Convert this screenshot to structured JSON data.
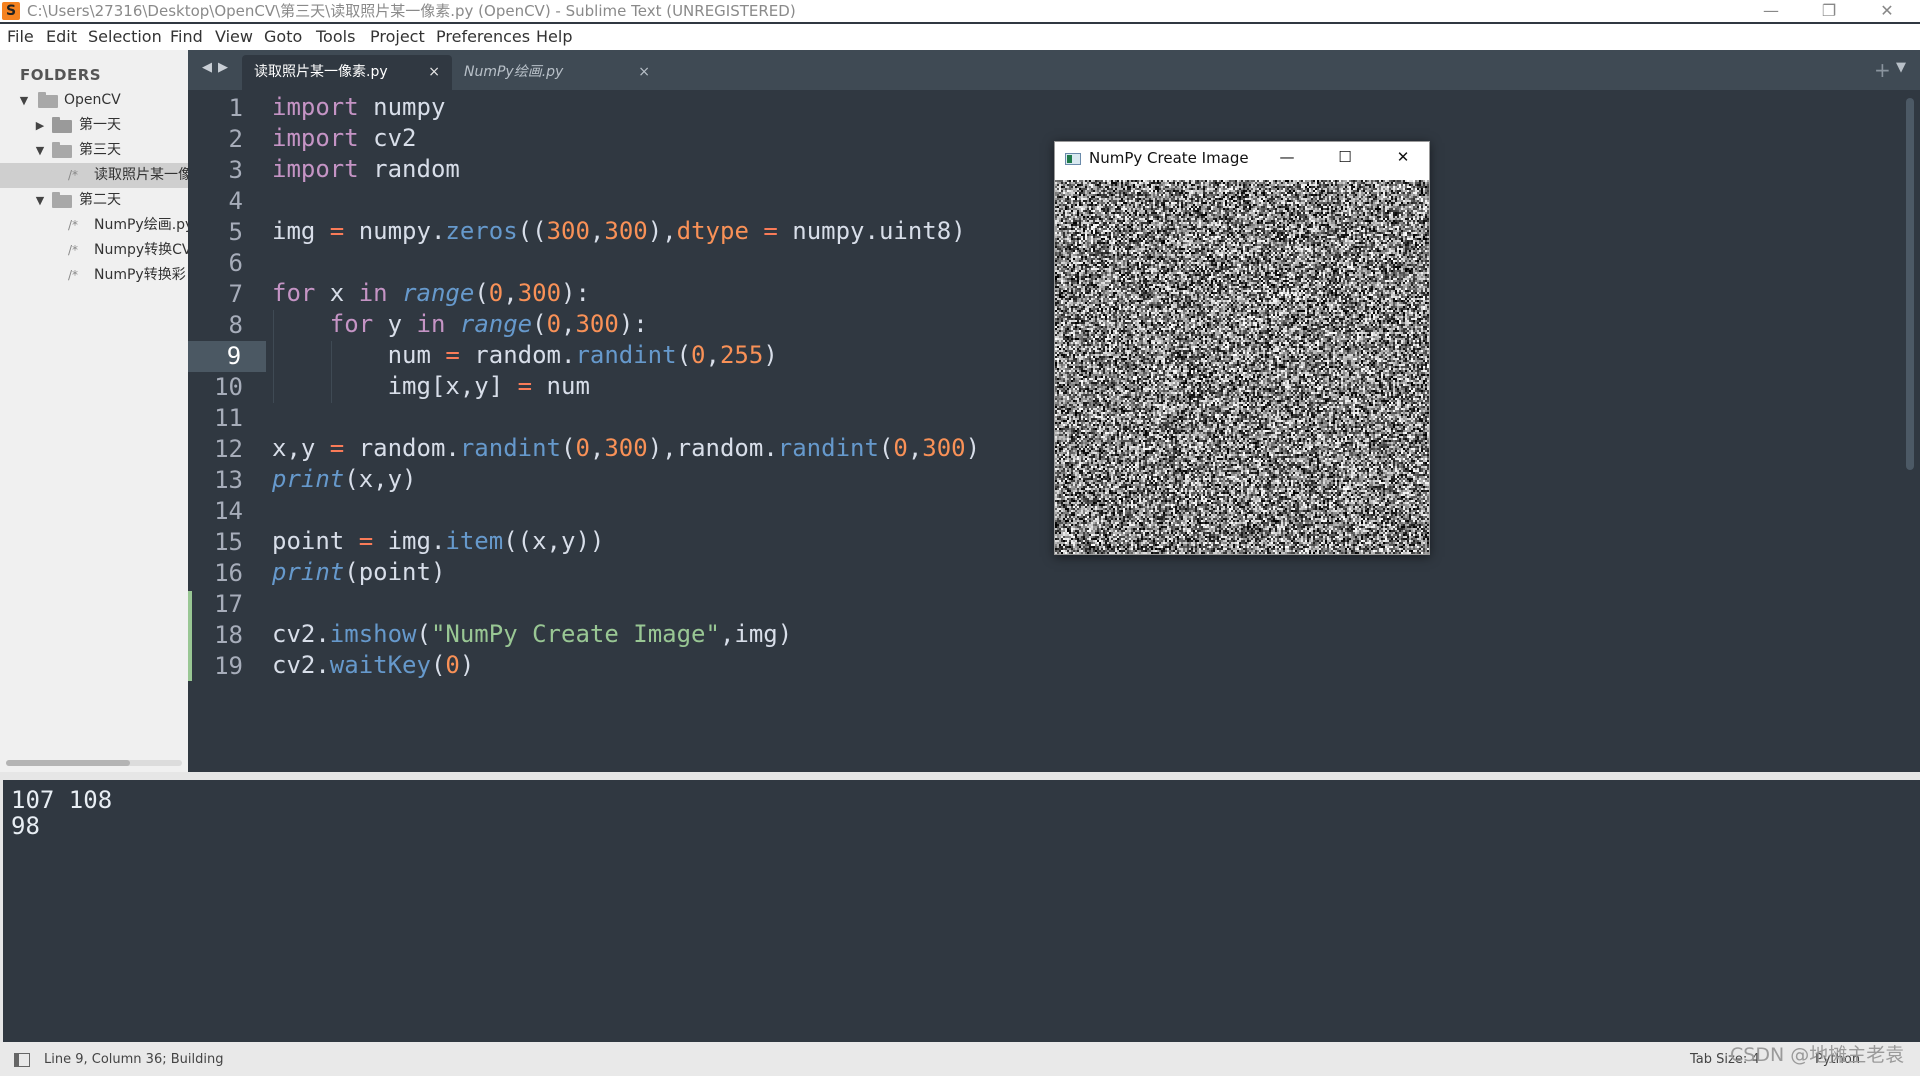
{
  "window": {
    "title": "C:\\Users\\27316\\Desktop\\OpenCV\\第三天\\读取照片某一像素.py (OpenCV) - Sublime Text (UNREGISTERED)",
    "minimize": "—",
    "maximize": "❐",
    "close": "✕",
    "app_icon": "S"
  },
  "menu": [
    "File",
    "Edit",
    "Selection",
    "Find",
    "View",
    "Goto",
    "Tools",
    "Project",
    "Preferences",
    "Help"
  ],
  "sidebar": {
    "header": "FOLDERS",
    "items": [
      {
        "type": "folder",
        "label": "OpenCV",
        "expanded": true
      },
      {
        "type": "folder",
        "label": "第一天",
        "expanded": false
      },
      {
        "type": "folder",
        "label": "第三天",
        "expanded": true
      },
      {
        "type": "file",
        "label": "读取照片某一像素.py",
        "display": "读取照片某一像",
        "selected": true
      },
      {
        "type": "folder",
        "label": "第二天",
        "expanded": true
      },
      {
        "type": "file",
        "label": "NumPy绘画.py",
        "display": "NumPy绘画.py"
      },
      {
        "type": "file",
        "label": "Numpy转换CV",
        "display": "Numpy转换CV"
      },
      {
        "type": "file",
        "label": "NumPy转换彩",
        "display": "NumPy转换彩"
      }
    ],
    "file_glyph": "/*"
  },
  "tabs": [
    {
      "label": "读取照片某一像素.py",
      "active": true
    },
    {
      "label": "NumPy绘画.py",
      "active": false
    }
  ],
  "tab_close": "×",
  "tab_nav": {
    "left": "◀",
    "right": "▶",
    "plus": "+",
    "dropdown": "▼"
  },
  "editor": {
    "current_line": 9,
    "line_numbers": [
      "1",
      "2",
      "3",
      "4",
      "5",
      "6",
      "7",
      "8",
      "9",
      "10",
      "11",
      "12",
      "13",
      "14",
      "15",
      "16",
      "17",
      "18",
      "19"
    ],
    "code_lines": [
      "import numpy",
      "import cv2",
      "import random",
      "",
      "img = numpy.zeros((300,300),dtype = numpy.uint8)",
      "",
      "for x in range(0,300):",
      "    for y in range(0,300):",
      "        num = random.randint(0,255)",
      "        img[x,y] = num",
      "",
      "x,y = random.randint(0,300),random.randint(0,300)",
      "print(x,y)",
      "",
      "point = img.item((x,y))",
      "print(point)",
      "",
      "cv2.imshow(\"NumPy Create Image\",img)",
      "cv2.waitKey(0)"
    ]
  },
  "image_window": {
    "title": "NumPy Create Image",
    "minimize": "—",
    "maximize": "☐",
    "close": "✕"
  },
  "console": {
    "lines": [
      "107 108",
      "98"
    ]
  },
  "statusbar": {
    "position": "Line 9, Column 36; Building",
    "tab_size": "Tab Size: 4",
    "syntax": "Python"
  },
  "watermark": "CSDN @地摊主老袁",
  "colors": {
    "editor_bg": "#303841",
    "keyword": "#c594c5",
    "function": "#6699cc",
    "number": "#f99157",
    "string": "#99c794"
  }
}
